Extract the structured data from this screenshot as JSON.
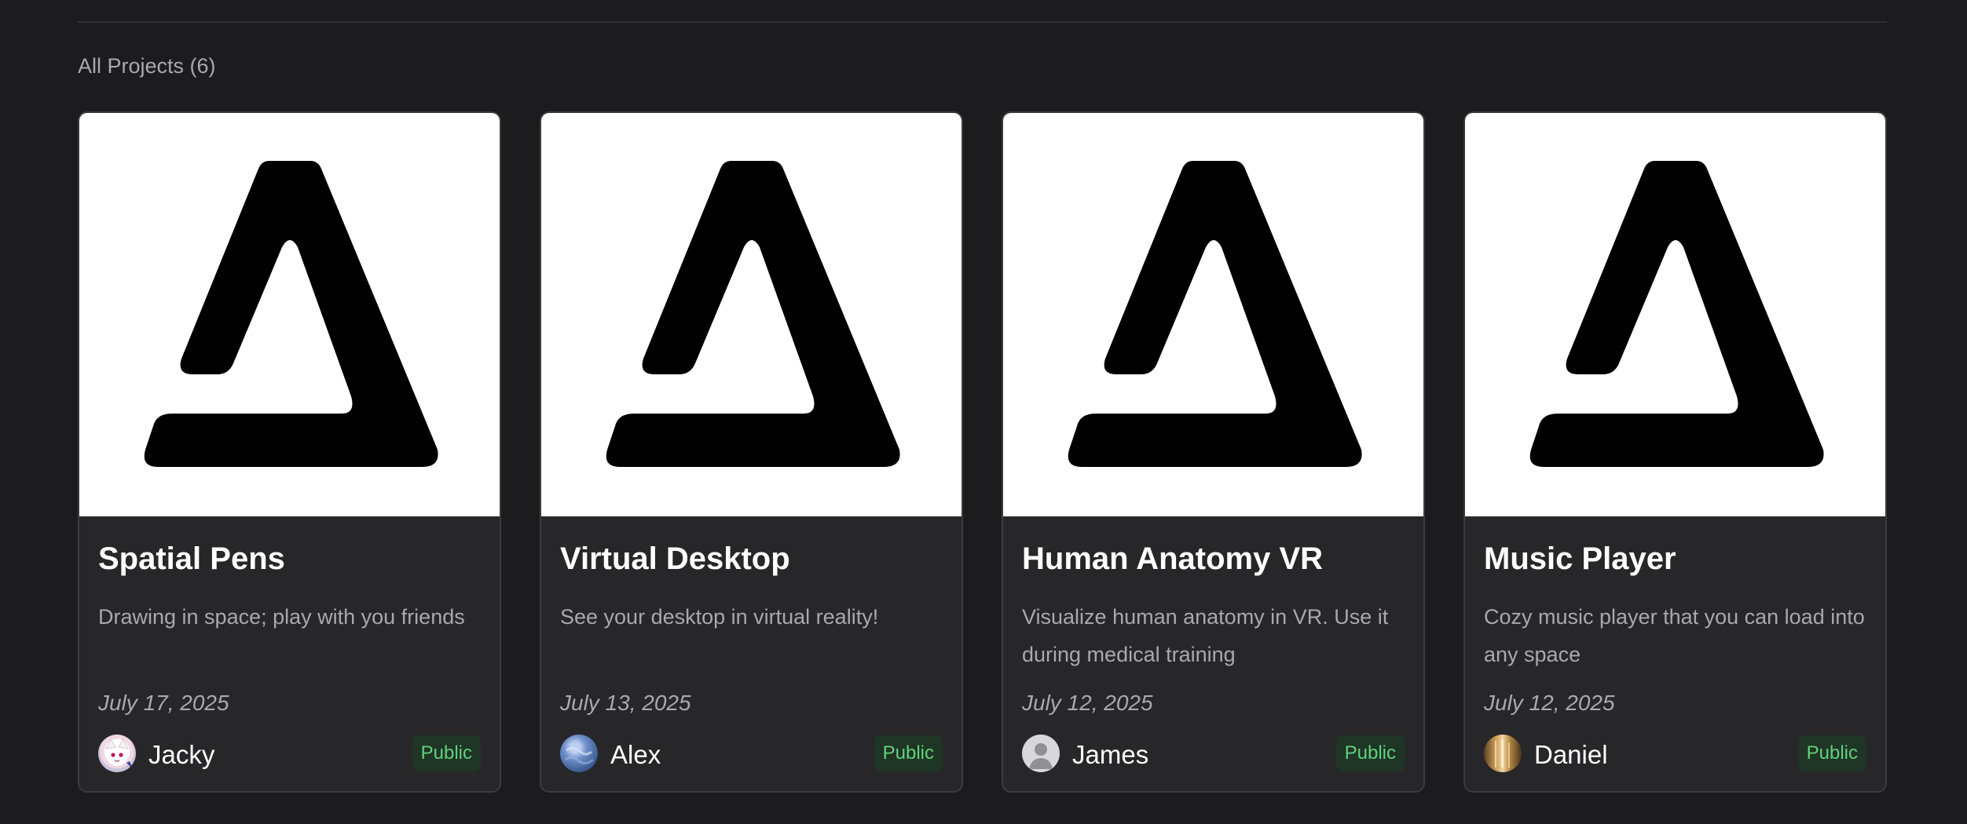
{
  "section": {
    "title": "All Projects (6)"
  },
  "projects": [
    {
      "title": "Spatial Pens",
      "description": "Drawing in space; play with you friends",
      "date": "July 17, 2025",
      "author": "Jacky",
      "visibility": "Public"
    },
    {
      "title": "Virtual Desktop",
      "description": "See your desktop in virtual reality!",
      "date": "July 13, 2025",
      "author": "Alex",
      "visibility": "Public"
    },
    {
      "title": "Human Anatomy VR",
      "description": "Visualize human anatomy in VR. Use it during medical training",
      "date": "July 12, 2025",
      "author": "James",
      "visibility": "Public"
    },
    {
      "title": "Music Player",
      "description": "Cozy music player that you can load into any space",
      "date": "July 12, 2025",
      "author": "Daniel",
      "visibility": "Public"
    }
  ],
  "colors": {
    "background": "#1c1c1e",
    "card": "#27272a",
    "badge_text": "#5fd27a",
    "badge_bg": "#1f3526"
  }
}
